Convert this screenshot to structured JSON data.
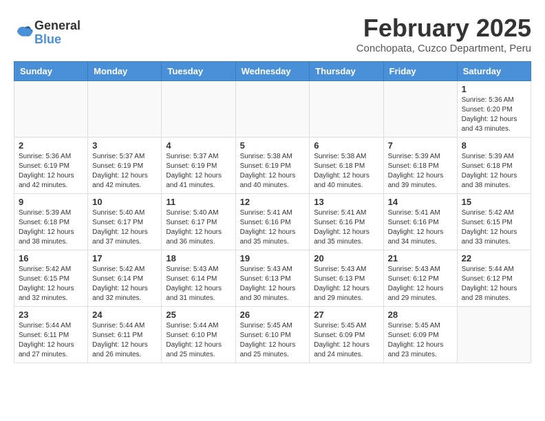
{
  "logo": {
    "general": "General",
    "blue": "Blue"
  },
  "title": {
    "month_year": "February 2025",
    "location": "Conchopata, Cuzco Department, Peru"
  },
  "headers": [
    "Sunday",
    "Monday",
    "Tuesday",
    "Wednesday",
    "Thursday",
    "Friday",
    "Saturday"
  ],
  "weeks": [
    [
      {
        "day": "",
        "info": ""
      },
      {
        "day": "",
        "info": ""
      },
      {
        "day": "",
        "info": ""
      },
      {
        "day": "",
        "info": ""
      },
      {
        "day": "",
        "info": ""
      },
      {
        "day": "",
        "info": ""
      },
      {
        "day": "1",
        "info": "Sunrise: 5:36 AM\nSunset: 6:20 PM\nDaylight: 12 hours\nand 43 minutes."
      }
    ],
    [
      {
        "day": "2",
        "info": "Sunrise: 5:36 AM\nSunset: 6:19 PM\nDaylight: 12 hours\nand 42 minutes."
      },
      {
        "day": "3",
        "info": "Sunrise: 5:37 AM\nSunset: 6:19 PM\nDaylight: 12 hours\nand 42 minutes."
      },
      {
        "day": "4",
        "info": "Sunrise: 5:37 AM\nSunset: 6:19 PM\nDaylight: 12 hours\nand 41 minutes."
      },
      {
        "day": "5",
        "info": "Sunrise: 5:38 AM\nSunset: 6:19 PM\nDaylight: 12 hours\nand 40 minutes."
      },
      {
        "day": "6",
        "info": "Sunrise: 5:38 AM\nSunset: 6:18 PM\nDaylight: 12 hours\nand 40 minutes."
      },
      {
        "day": "7",
        "info": "Sunrise: 5:39 AM\nSunset: 6:18 PM\nDaylight: 12 hours\nand 39 minutes."
      },
      {
        "day": "8",
        "info": "Sunrise: 5:39 AM\nSunset: 6:18 PM\nDaylight: 12 hours\nand 38 minutes."
      }
    ],
    [
      {
        "day": "9",
        "info": "Sunrise: 5:39 AM\nSunset: 6:18 PM\nDaylight: 12 hours\nand 38 minutes."
      },
      {
        "day": "10",
        "info": "Sunrise: 5:40 AM\nSunset: 6:17 PM\nDaylight: 12 hours\nand 37 minutes."
      },
      {
        "day": "11",
        "info": "Sunrise: 5:40 AM\nSunset: 6:17 PM\nDaylight: 12 hours\nand 36 minutes."
      },
      {
        "day": "12",
        "info": "Sunrise: 5:41 AM\nSunset: 6:16 PM\nDaylight: 12 hours\nand 35 minutes."
      },
      {
        "day": "13",
        "info": "Sunrise: 5:41 AM\nSunset: 6:16 PM\nDaylight: 12 hours\nand 35 minutes."
      },
      {
        "day": "14",
        "info": "Sunrise: 5:41 AM\nSunset: 6:16 PM\nDaylight: 12 hours\nand 34 minutes."
      },
      {
        "day": "15",
        "info": "Sunrise: 5:42 AM\nSunset: 6:15 PM\nDaylight: 12 hours\nand 33 minutes."
      }
    ],
    [
      {
        "day": "16",
        "info": "Sunrise: 5:42 AM\nSunset: 6:15 PM\nDaylight: 12 hours\nand 32 minutes."
      },
      {
        "day": "17",
        "info": "Sunrise: 5:42 AM\nSunset: 6:14 PM\nDaylight: 12 hours\nand 32 minutes."
      },
      {
        "day": "18",
        "info": "Sunrise: 5:43 AM\nSunset: 6:14 PM\nDaylight: 12 hours\nand 31 minutes."
      },
      {
        "day": "19",
        "info": "Sunrise: 5:43 AM\nSunset: 6:13 PM\nDaylight: 12 hours\nand 30 minutes."
      },
      {
        "day": "20",
        "info": "Sunrise: 5:43 AM\nSunset: 6:13 PM\nDaylight: 12 hours\nand 29 minutes."
      },
      {
        "day": "21",
        "info": "Sunrise: 5:43 AM\nSunset: 6:12 PM\nDaylight: 12 hours\nand 29 minutes."
      },
      {
        "day": "22",
        "info": "Sunrise: 5:44 AM\nSunset: 6:12 PM\nDaylight: 12 hours\nand 28 minutes."
      }
    ],
    [
      {
        "day": "23",
        "info": "Sunrise: 5:44 AM\nSunset: 6:11 PM\nDaylight: 12 hours\nand 27 minutes."
      },
      {
        "day": "24",
        "info": "Sunrise: 5:44 AM\nSunset: 6:11 PM\nDaylight: 12 hours\nand 26 minutes."
      },
      {
        "day": "25",
        "info": "Sunrise: 5:44 AM\nSunset: 6:10 PM\nDaylight: 12 hours\nand 25 minutes."
      },
      {
        "day": "26",
        "info": "Sunrise: 5:45 AM\nSunset: 6:10 PM\nDaylight: 12 hours\nand 25 minutes."
      },
      {
        "day": "27",
        "info": "Sunrise: 5:45 AM\nSunset: 6:09 PM\nDaylight: 12 hours\nand 24 minutes."
      },
      {
        "day": "28",
        "info": "Sunrise: 5:45 AM\nSunset: 6:09 PM\nDaylight: 12 hours\nand 23 minutes."
      },
      {
        "day": "",
        "info": ""
      }
    ]
  ]
}
